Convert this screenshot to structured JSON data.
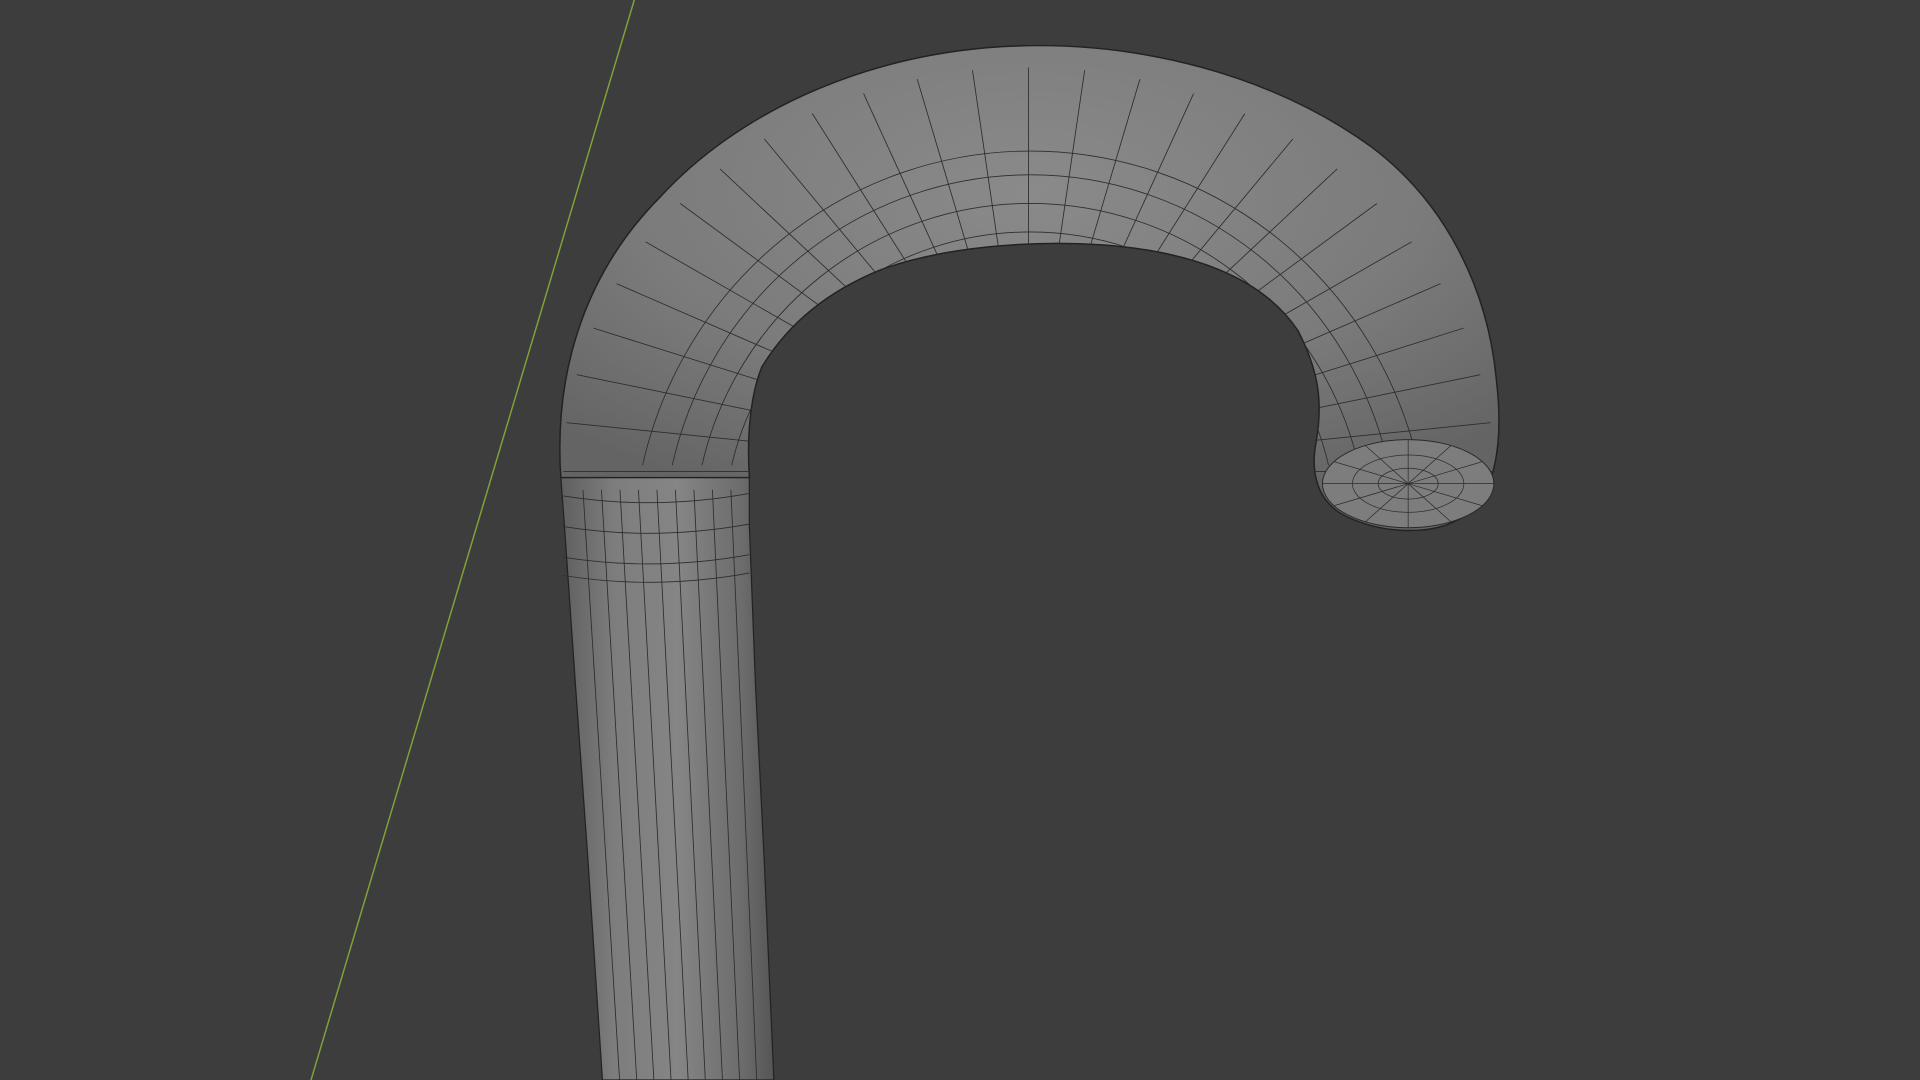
{
  "viewport": {
    "background_color": "#3d3d3d",
    "shading": "solid",
    "overlay": "wireframe"
  },
  "axis_line": {
    "axis": "Y",
    "color": "#7ea33a"
  },
  "mesh": {
    "object": "cane",
    "surface_color": "#7a7a7a",
    "edge_color": "#2a2a2a"
  }
}
